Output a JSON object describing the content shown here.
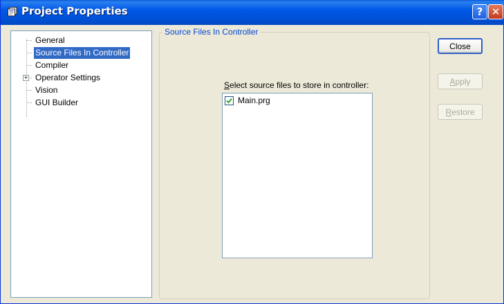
{
  "window": {
    "title": "Project Properties",
    "help_glyph": "?",
    "close_glyph": "✕"
  },
  "tree": {
    "items": [
      {
        "label": "General",
        "selected": false,
        "expandable": false
      },
      {
        "label": "Source Files In Controller",
        "selected": true,
        "expandable": false
      },
      {
        "label": "Compiler",
        "selected": false,
        "expandable": false
      },
      {
        "label": "Operator Settings",
        "selected": false,
        "expandable": true,
        "expander_glyph": "+"
      },
      {
        "label": "Vision",
        "selected": false,
        "expandable": false
      },
      {
        "label": "GUI Builder",
        "selected": false,
        "expandable": false
      }
    ]
  },
  "panel": {
    "group_title": "Source Files In Controller",
    "list_label_mnemonic": "S",
    "list_label_rest": "elect source files to store in controller:",
    "files": [
      {
        "name": "Main.prg",
        "checked": true
      }
    ]
  },
  "buttons": {
    "close": {
      "label": "Close",
      "enabled": true
    },
    "apply": {
      "mnemonic": "A",
      "rest": "pply",
      "enabled": false
    },
    "restore": {
      "mnemonic": "R",
      "rest": "estore",
      "enabled": false
    }
  },
  "colors": {
    "titlebar": "#0058e6",
    "selection": "#316ac5",
    "group_title": "#0046d5",
    "dialog_bg": "#ece9d8"
  },
  "icons": {
    "title": "properties-window-icon",
    "help": "help-icon",
    "close": "close-icon",
    "check": "checkmark-icon",
    "expander": "plus-expander-icon"
  }
}
